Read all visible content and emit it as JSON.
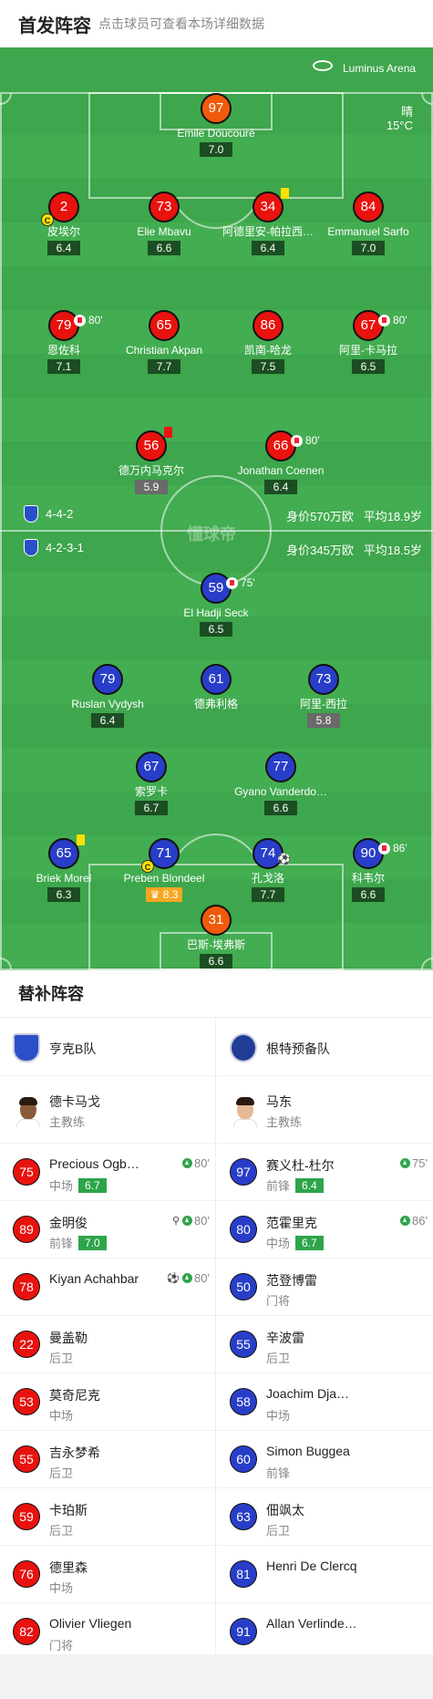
{
  "header": {
    "title": "首发阵容",
    "subtitle": "点击球员可查看本场详细数据"
  },
  "venue": {
    "name": "Luminus Arena",
    "weather": "晴",
    "temp": "15°C"
  },
  "home_bar": {
    "formation": "4-4-2",
    "value": "身价570万欧",
    "age": "平均18.9岁"
  },
  "away_bar": {
    "formation": "4-2-3-1",
    "value": "身价345万欧",
    "age": "平均18.5岁"
  },
  "watermark": "懂球帝",
  "home": {
    "gk": {
      "num": "97",
      "name": "Emile Doucouré",
      "rating": "7.0"
    },
    "def": [
      {
        "num": "2",
        "name": "皮埃尔",
        "rating": "6.4",
        "captain": "C"
      },
      {
        "num": "73",
        "name": "Elie Mbavu",
        "rating": "6.6"
      },
      {
        "num": "34",
        "name": "阿德里安-帕拉西…",
        "rating": "6.4"
      },
      {
        "num": "84",
        "name": "Emmanuel Sarfo",
        "rating": "7.0"
      }
    ],
    "mid": [
      {
        "num": "79",
        "name": "恩佐科",
        "rating": "7.1",
        "sub": "80'"
      },
      {
        "num": "65",
        "name": "Christian Akpan",
        "rating": "7.7"
      },
      {
        "num": "86",
        "name": "凯南-哈龙",
        "rating": "7.5"
      },
      {
        "num": "67",
        "name": "阿里-卡马拉",
        "rating": "6.5",
        "sub": "80'"
      }
    ],
    "fwd": [
      {
        "num": "56",
        "name": "德万内马克尔",
        "rating": "5.9"
      },
      {
        "num": "66",
        "name": "Jonathan Coenen",
        "rating": "6.4",
        "sub": "80'"
      }
    ]
  },
  "away": {
    "am": {
      "num": "59",
      "name": "El Hadji Seck",
      "rating": "6.5",
      "sub": "75'"
    },
    "att": [
      {
        "num": "79",
        "name": "Ruslan Vydysh",
        "rating": "6.4"
      },
      {
        "num": "61",
        "name": "德弗利格",
        "rating": ""
      },
      {
        "num": "73",
        "name": "阿里-西拉",
        "rating": "5.8"
      }
    ],
    "dm": [
      {
        "num": "67",
        "name": "索罗卡",
        "rating": "6.7"
      },
      {
        "num": "77",
        "name": "Gyano Vanderdo…",
        "rating": "6.6"
      }
    ],
    "def": [
      {
        "num": "65",
        "name": "Briek Morel",
        "rating": "6.3"
      },
      {
        "num": "71",
        "name": "Preben Blondeel",
        "rating": "8.3",
        "captain": "C"
      },
      {
        "num": "74",
        "name": "孔戈洛",
        "rating": "7.7"
      },
      {
        "num": "90",
        "name": "科韦尔",
        "rating": "6.6",
        "sub": "86'"
      }
    ],
    "gk": {
      "num": "31",
      "name": "巴斯-埃弗斯",
      "rating": "6.6"
    }
  },
  "subs": {
    "title": "替补阵容",
    "left": {
      "team": "亨克B队",
      "coach": {
        "name": "德卡马戈",
        "role": "主教练"
      },
      "players": [
        {
          "num": "75",
          "name": "Precious Ogb…",
          "pos": "中场",
          "rating": "6.7",
          "min": "80'"
        },
        {
          "num": "89",
          "name": "金明俊",
          "pos": "前锋",
          "rating": "7.0",
          "min": "80'"
        },
        {
          "num": "78",
          "name": "Kiyan Achahbar",
          "pos": "",
          "rating": "",
          "min": "80'"
        },
        {
          "num": "22",
          "name": "曼盖勒",
          "pos": "后卫",
          "rating": "",
          "min": ""
        },
        {
          "num": "53",
          "name": "莫奇尼克",
          "pos": "中场",
          "rating": "",
          "min": ""
        },
        {
          "num": "55",
          "name": "吉永梦希",
          "pos": "后卫",
          "rating": "",
          "min": ""
        },
        {
          "num": "59",
          "name": "卡珀斯",
          "pos": "后卫",
          "rating": "",
          "min": ""
        },
        {
          "num": "76",
          "name": "德里森",
          "pos": "中场",
          "rating": "",
          "min": ""
        },
        {
          "num": "82",
          "name": "Olivier Vliegen",
          "pos": "门将",
          "rating": "",
          "min": ""
        }
      ]
    },
    "right": {
      "team": "根特预备队",
      "coach": {
        "name": "马东",
        "role": "主教练"
      },
      "players": [
        {
          "num": "97",
          "name": "赛义杜-杜尔",
          "pos": "前锋",
          "rating": "6.4",
          "min": "75'"
        },
        {
          "num": "80",
          "name": "范霍里克",
          "pos": "中场",
          "rating": "6.7",
          "min": "86'"
        },
        {
          "num": "50",
          "name": "范登博雷",
          "pos": "门将",
          "rating": "",
          "min": ""
        },
        {
          "num": "55",
          "name": "辛波雷",
          "pos": "后卫",
          "rating": "",
          "min": ""
        },
        {
          "num": "58",
          "name": "Joachim Dja…",
          "pos": "中场",
          "rating": "",
          "min": ""
        },
        {
          "num": "60",
          "name": "Simon Buggea",
          "pos": "前锋",
          "rating": "",
          "min": ""
        },
        {
          "num": "63",
          "name": "佃飒太",
          "pos": "后卫",
          "rating": "",
          "min": ""
        },
        {
          "num": "81",
          "name": "Henri De Clercq",
          "pos": "",
          "rating": "",
          "min": ""
        },
        {
          "num": "91",
          "name": "Allan Verlinde…",
          "pos": "",
          "rating": "",
          "min": ""
        }
      ]
    }
  },
  "colors": {
    "home": "#e8120e",
    "home_gk": "#f05a0a",
    "away": "#283ec8",
    "away_gk": "#f05a0a",
    "pitch": "#3ea64c"
  }
}
